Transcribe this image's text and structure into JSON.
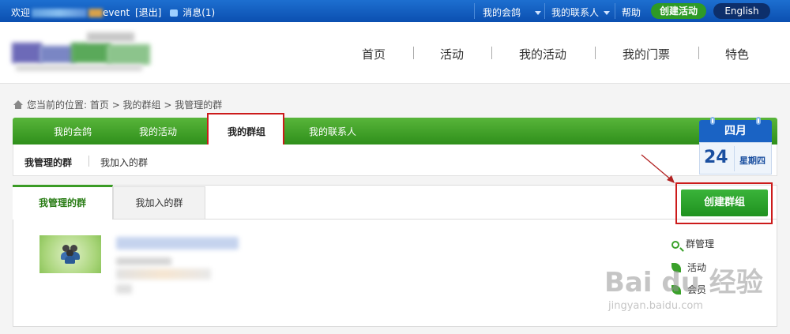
{
  "topbar": {
    "welcome": "欢迎",
    "user_suffix": "event",
    "logout": "[退出]",
    "messages": "消息(1)",
    "my_events": "我的会鸽",
    "my_contacts": "我的联系人",
    "help": "帮助",
    "create_activity": "创建活动",
    "language": "English",
    "brand_color": "#0b4fb0"
  },
  "nav": {
    "items": [
      "首页",
      "活动",
      "我的活动",
      "我的门票",
      "特色"
    ]
  },
  "breadcrumb": {
    "prefix": "您当前的位置:",
    "path": "首页 > 我的群组 > 我管理的群"
  },
  "greenbar": {
    "tabs": [
      "我的会鸽",
      "我的活动",
      "我的群组",
      "我的联系人"
    ],
    "active_index": 2,
    "accent": "#2f8f1b"
  },
  "subbar": {
    "items": [
      "我管理的群",
      "我加入的群"
    ]
  },
  "calendar": {
    "month": "四月",
    "day": "24",
    "weekday": "星期四"
  },
  "panel": {
    "tabs": [
      "我管理的群",
      "我加入的群"
    ],
    "create_group": "创建群组",
    "side_links": [
      "群管理",
      "活动",
      "会员"
    ]
  },
  "watermark": {
    "main": "Bai du 经验",
    "sub": "jingyan.baidu.com"
  }
}
